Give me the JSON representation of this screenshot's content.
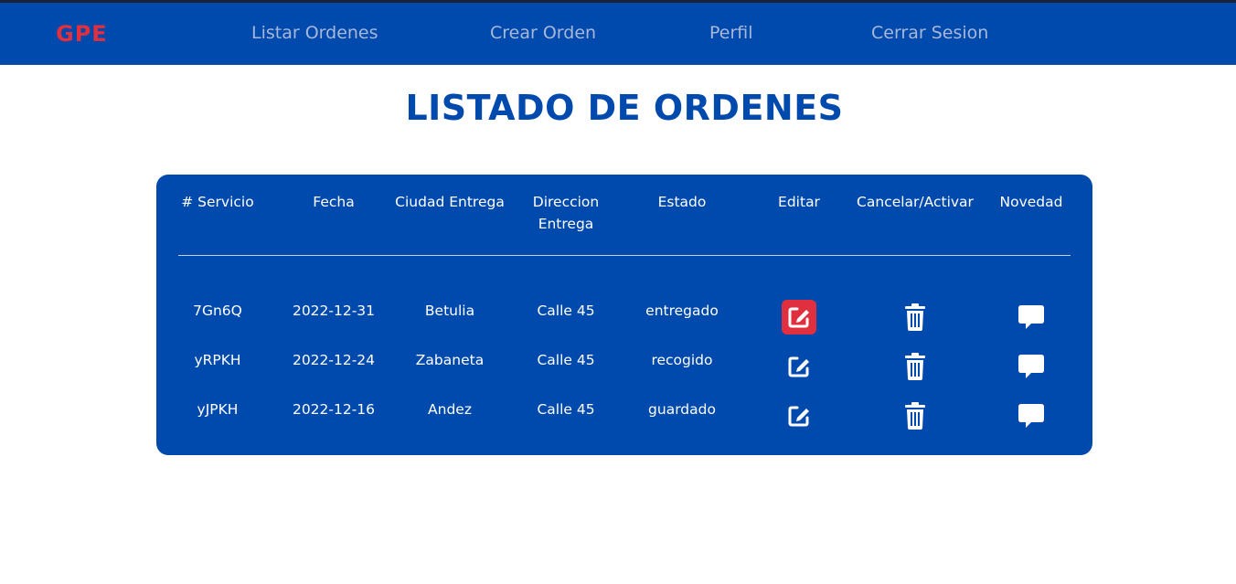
{
  "navbar": {
    "brand": "GPE",
    "links": [
      "Listar Ordenes",
      "Crear Orden",
      "Perfil",
      "Cerrar Sesion"
    ]
  },
  "page": {
    "title": "LISTADO DE ORDENES"
  },
  "table": {
    "headers": [
      "# Servicio",
      "Fecha",
      "Ciudad Entrega",
      "Direccion Entrega",
      "Estado",
      "Editar",
      "Cancelar/Activar",
      "Novedad"
    ],
    "rows": [
      {
        "servicio": "7Gn6Q",
        "fecha": "2022-12-31",
        "ciudad": "Betulia",
        "direccion": "Calle 45",
        "estado": "entregado"
      },
      {
        "servicio": "yRPKH",
        "fecha": "2022-12-24",
        "ciudad": "Zabaneta",
        "direccion": "Calle 45",
        "estado": "recogido"
      },
      {
        "servicio": "yJPKH",
        "fecha": "2022-12-16",
        "ciudad": "Andez",
        "direccion": "Calle 45",
        "estado": "guardado"
      }
    ],
    "icons": {
      "edit": "edit-icon",
      "cancel": "trash-icon",
      "novedad": "comment-icon"
    }
  },
  "colors": {
    "primary": "#0049ad",
    "brand": "#e0303f",
    "nav_text": "#a8b8d8",
    "table_text": "#ffffff"
  }
}
